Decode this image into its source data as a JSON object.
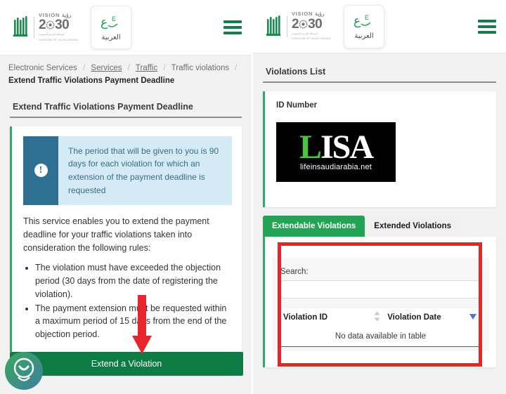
{
  "header": {
    "vision_top": "VISION",
    "vision_arabic": "رؤية",
    "vision_year": "2030",
    "vision_sub_ar": "المملكة العربية السعودية",
    "vision_sub_en": "KINGDOM OF SAUDI ARABIA",
    "lang_glyph": "ع E",
    "lang_label": "العربية",
    "menu_icon": "hamburger-menu-icon"
  },
  "breadcrumb": {
    "items": [
      {
        "label": "Electronic Services",
        "link": false
      },
      {
        "label": "Services",
        "link": true
      },
      {
        "label": "Traffic",
        "link": true
      },
      {
        "label": "Traffic violations",
        "link": false
      }
    ],
    "separator": "/",
    "current": "Extend Traffic Violations Payment Deadline"
  },
  "left": {
    "section_title": "Extend Traffic Violations Payment Deadline",
    "alert": {
      "icon": "exclamation-circle-icon",
      "text": "The period that will be given to you is 90 days for each violation for which an extension of the payment deadline is requested"
    },
    "intro": "This service enables you to extend the payment deadline for your traffic violations taken into consideration the following rules:",
    "rules": [
      "The violation must have exceeded the objection period (30 days from the date of registering the violation).",
      "The payment extension must be requested within a maximum period of 15 days from the end of the objection period."
    ],
    "cta_label": "Extend a Violation"
  },
  "right": {
    "section_title": "Violations List",
    "id_label": "ID Number",
    "watermark": {
      "word_first": "L",
      "word_rest": "ISA",
      "subtitle": "lifeinsaudiarabia.net"
    },
    "tabs": [
      {
        "label": "Extendable Violations",
        "active": true
      },
      {
        "label": "Extended Violations",
        "active": false
      }
    ],
    "search_label": "Search:",
    "search_value": "",
    "search_placeholder": "",
    "table": {
      "columns": [
        {
          "label": "Violation ID",
          "sort": "none"
        },
        {
          "label": "Violation Date",
          "sort": "desc"
        }
      ],
      "empty_message": "No data available in table",
      "rows": []
    }
  },
  "widgets": {
    "chat_icon": "chat-support-icon"
  },
  "annotations": {
    "arrow": "red-down-arrow",
    "highlight": "red-highlight-box"
  },
  "colors": {
    "brand_green": "#0e7a44",
    "tab_green": "#23a455",
    "accent_stripe": "#2fa86a",
    "alert_bg": "#d4eaf5",
    "alert_icon_bg": "#2e6f92",
    "annotation_red": "#e8252a"
  }
}
